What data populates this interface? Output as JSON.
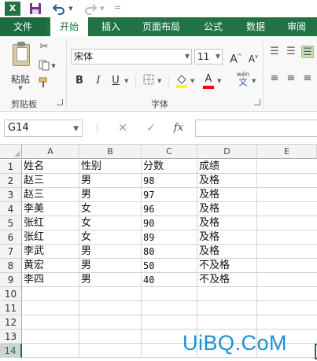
{
  "quick_access": {
    "app_icon": "excel-icon",
    "app_letter": "X",
    "save_icon": "save-icon",
    "undo_icon": "undo-icon",
    "redo_icon": "redo-icon",
    "customize_icon": "customize-icon"
  },
  "tabs": [
    {
      "label": "文件"
    },
    {
      "label": "开始"
    },
    {
      "label": "插入"
    },
    {
      "label": "页面布局"
    },
    {
      "label": "公式"
    },
    {
      "label": "数据"
    },
    {
      "label": "审阅"
    }
  ],
  "ribbon": {
    "clipboard": {
      "paste_label": "粘贴",
      "group_label": "剪贴板"
    },
    "font": {
      "font_name": "宋体",
      "font_size": "11",
      "bold": "B",
      "italic": "I",
      "underline": "U",
      "grow": "A",
      "shrink": "A",
      "font_color_letter": "A",
      "phonetic": "wén",
      "phonetic_char": "文",
      "group_label": "字体"
    },
    "colors": {
      "accent": "#217346",
      "highlight": "#ffff00",
      "font_color": "#ff0000"
    }
  },
  "formula_bar": {
    "name_box": "G14",
    "cancel_icon": "✕",
    "enter_icon": "✓",
    "fx": "fx",
    "value": ""
  },
  "sheet": {
    "columns": [
      "A",
      "B",
      "C",
      "D",
      "E"
    ],
    "rows": [
      "1",
      "2",
      "3",
      "4",
      "5",
      "6",
      "7",
      "8",
      "9",
      "10",
      "11",
      "12",
      "13",
      "14"
    ],
    "selected_row": "14",
    "data": [
      [
        "姓名",
        "性别",
        "分数",
        "成绩"
      ],
      [
        "赵三",
        "男",
        "98",
        "及格"
      ],
      [
        "赵三",
        "男",
        "97",
        "及格"
      ],
      [
        "李美",
        "女",
        "96",
        "及格"
      ],
      [
        "张红",
        "女",
        "90",
        "及格"
      ],
      [
        "张红",
        "女",
        "89",
        "及格"
      ],
      [
        "李武",
        "男",
        "80",
        "及格"
      ],
      [
        "黄宏",
        "男",
        "50",
        "不及格"
      ],
      [
        "李四",
        "男",
        "40",
        "不及格"
      ]
    ]
  },
  "watermark": "UiBQ.CoM"
}
